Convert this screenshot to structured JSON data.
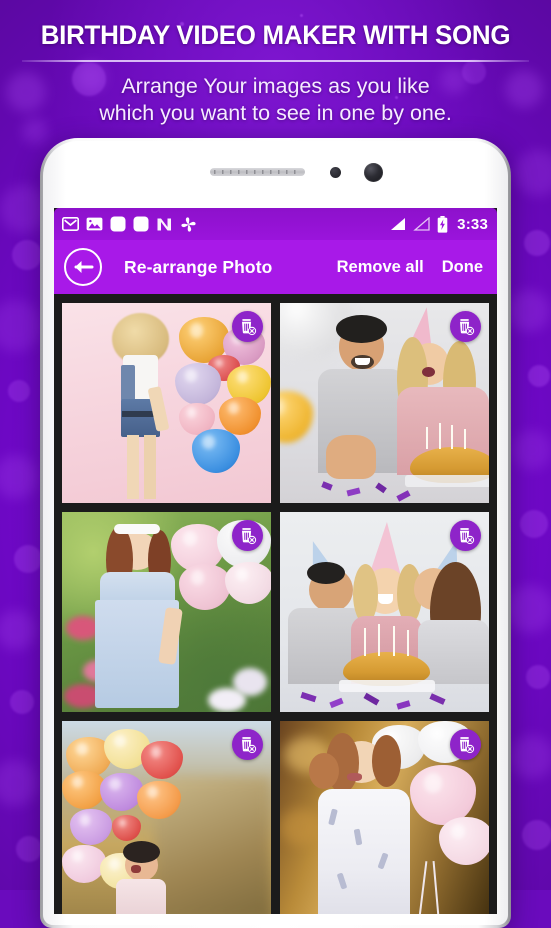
{
  "promo": {
    "title": "BIRTHDAY VIDEO MAKER WITH SONG",
    "subtitle_line1": "Arrange Your images as you like",
    "subtitle_line2": "which you want to see in one by one.",
    "background_color": "#7a12d6",
    "accent_color": "#a819e8"
  },
  "phone": {
    "frame_color": "#ffffff",
    "hardware": {
      "speaker": "speaker-grille",
      "sensor": "proximity-sensor",
      "camera": "front-camera"
    }
  },
  "status_bar": {
    "background_color": "#9a14dc",
    "time": "3:33",
    "left_icons": [
      "gmail-icon",
      "photos-icon",
      "app-placeholder-icon",
      "app-placeholder-icon",
      "nougat-n-icon",
      "pinwheel-icon"
    ],
    "right_icons": [
      "signal-full-icon",
      "signal-empty-icon",
      "battery-charging-icon"
    ]
  },
  "toolbar": {
    "background_color": "#a819e8",
    "back_icon": "back-arrow-icon",
    "title": "Re-arrange Photo",
    "remove_all_label": "Remove all",
    "done_label": "Done"
  },
  "grid": {
    "background_color": "#1b1b1b",
    "columns": 2,
    "delete_icon": "trash-delete-icon",
    "delete_badge_color": "#8e24c9",
    "photos": [
      {
        "id": "p1",
        "description": "Woman in denim overalls holding colorful balloons on pink background"
      },
      {
        "id": "p2",
        "description": "Smiling man and woman with party hat beside a birthday cake"
      },
      {
        "id": "p3",
        "description": "Girl in light blue dress with pink balloons in a garden"
      },
      {
        "id": "p4",
        "description": "Man and woman kissing a smiling woman behind a birthday cake, all in party hats"
      },
      {
        "id": "p5",
        "description": "Child in a wheat field holding pastel balloons"
      },
      {
        "id": "p6",
        "description": "Little girl in white dress with pink balloons and a tiara"
      }
    ]
  }
}
